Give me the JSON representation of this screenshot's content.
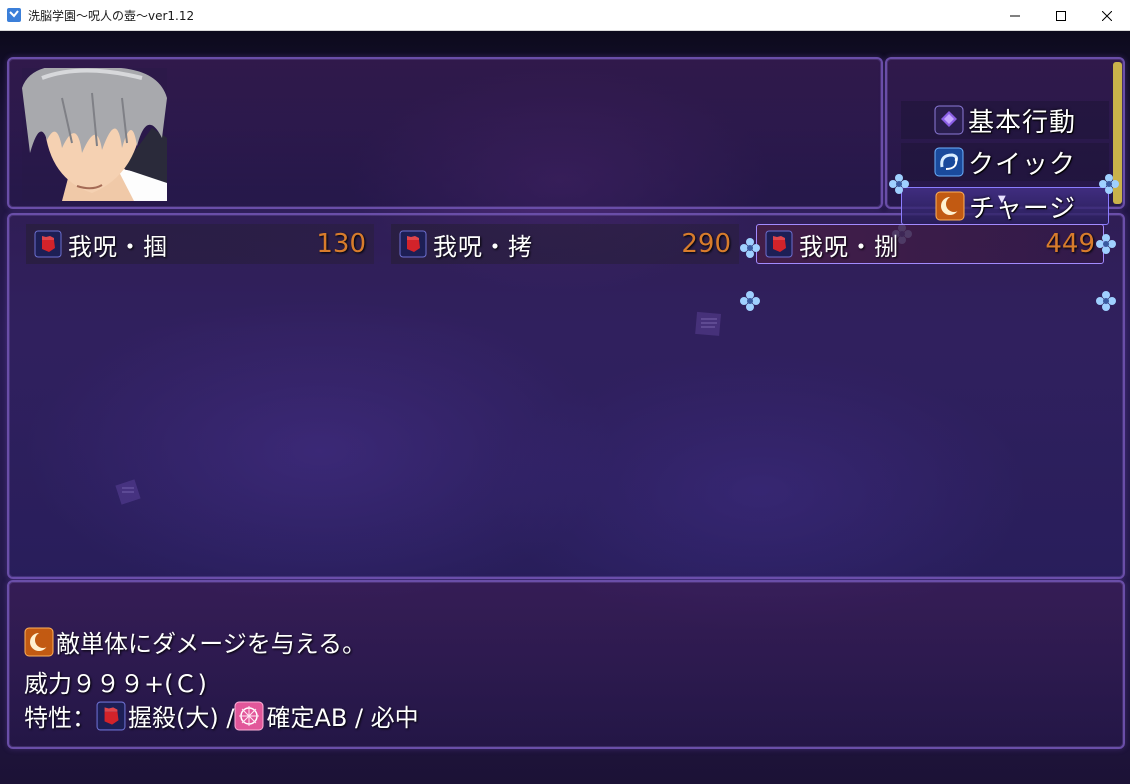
{
  "window": {
    "title": "洗脳学園～呪人の壺～ver1.12",
    "minimize_icon": "minimize-icon",
    "maximize_icon": "maximize-icon",
    "close_icon": "close-icon"
  },
  "commands": [
    {
      "label": "基本行動",
      "icon": "scroll-icon",
      "selected": false
    },
    {
      "label": "クイック",
      "icon": "swirl-icon",
      "selected": false
    },
    {
      "label": "チャージ",
      "icon": "crescent-icon",
      "selected": true
    }
  ],
  "skills": [
    {
      "name": "我呪・掴",
      "cost": "130",
      "icon": "fist-icon",
      "selected": false
    },
    {
      "name": "我呪・拷",
      "cost": "290",
      "icon": "fist-icon",
      "selected": false
    },
    {
      "name": "我呪・捌",
      "cost": "449",
      "icon": "fist-icon",
      "selected": true
    }
  ],
  "help": {
    "line1": "敵単体にダメージを与える。",
    "line2": "威力９９９+(Ｃ)",
    "line3_prefix": "特性：",
    "trait1": "握殺(大) / ",
    "trait2": "確定AB / 必中"
  },
  "colors": {
    "cost": "#d87c2c",
    "panel_border": "#6a4ea8",
    "selection_border": "#a38bff"
  }
}
